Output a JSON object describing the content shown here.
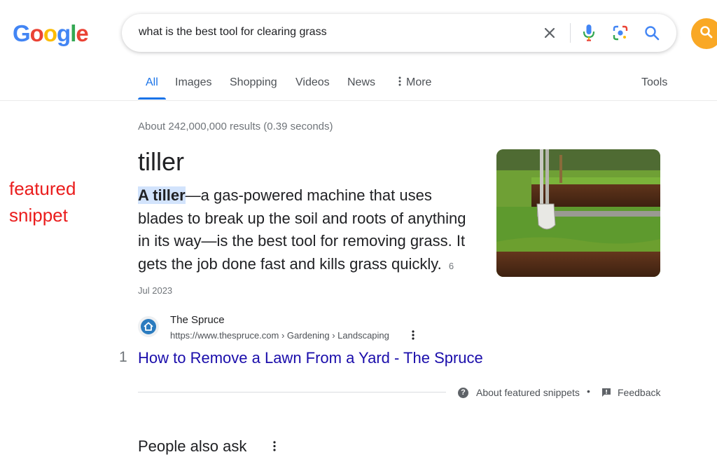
{
  "header": {
    "logo": {
      "letters": [
        "G",
        "o",
        "o",
        "g",
        "l",
        "e"
      ],
      "colors": [
        "#4285F4",
        "#EA4335",
        "#FBBC05",
        "#4285F4",
        "#34A853",
        "#EA4335"
      ]
    },
    "search": {
      "query": "what is the best tool for clearing grass",
      "icons": [
        "clear-x-icon",
        "microphone-icon",
        "lens-camera-icon",
        "search-icon"
      ]
    },
    "account_button_icon": "search-icon",
    "accent_color": "#F9A825"
  },
  "tabs": {
    "items": [
      "All",
      "Images",
      "Shopping",
      "Videos",
      "News",
      "More"
    ],
    "active": "All",
    "tools_label": "Tools"
  },
  "results": {
    "stats": "About 242,000,000 results (0.39 seconds)"
  },
  "annotation": {
    "line1": "featured",
    "line2": "snippet",
    "color": "#EA1C1C"
  },
  "featured_snippet": {
    "answer": "tiller",
    "highlight": "A tiller",
    "body": "—a gas-powered machine that uses blades to break up the soil and roots of anything in its way—is the best tool for removing grass. It gets the job done fast and kills grass quickly.",
    "date": "6 Jul 2023",
    "image_description_icon": "lawn-with-spade-image"
  },
  "source": {
    "site_name": "The Spruce",
    "url_breadcrumb": "https://www.thespruce.com › Gardening › Landscaping",
    "rank": "1",
    "link_title": "How to Remove a Lawn From a Yard - The Spruce",
    "favicon_icon": "house-icon"
  },
  "snippet_footer": {
    "about_label": "About featured snippets",
    "separator": "•",
    "feedback_label": "Feedback"
  },
  "people_also_ask": {
    "title": "People also ask"
  }
}
